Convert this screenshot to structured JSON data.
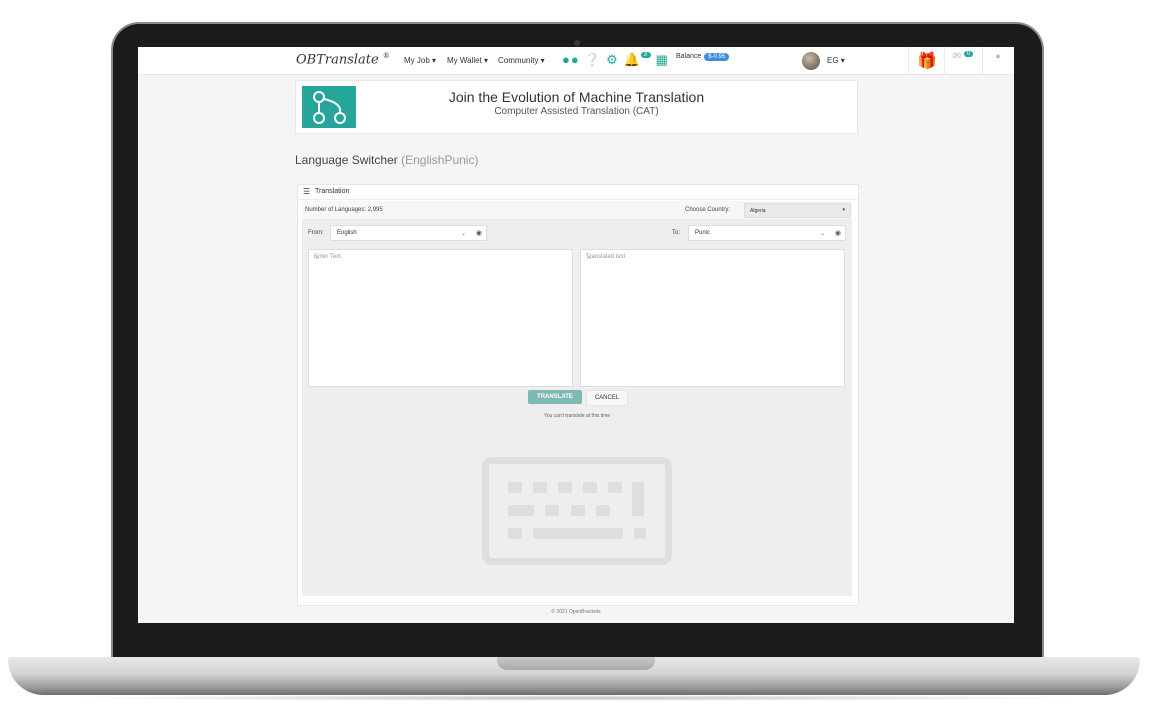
{
  "navbar": {
    "brand": "OBTranslate",
    "brand_mark": "®",
    "menu": [
      "My Job ▾",
      "My Wallet ▾",
      "Community ▾"
    ],
    "notification_count": "3",
    "balance_label": "Balance",
    "balance_value": "$-0.95",
    "language": "EG ▾",
    "mail_count": "0"
  },
  "header": {
    "title": "Join the Evolution of Machine Translation",
    "subtitle": "Computer Assisted Translation (CAT)"
  },
  "page": {
    "title": "Language Switcher",
    "pair": "(EnglishPunic)"
  },
  "panel": {
    "title": "Translation",
    "language_count": "Number of Languages: 2,995",
    "country_label": "Choose Country:",
    "country_value": "Algeria",
    "from_label": "From:",
    "from_value": "English",
    "to_label": "To:",
    "to_value": "Punic",
    "source_placeholder": "Enter Text",
    "target_placeholder": "Translated text",
    "translate_label": "TRANSLATE",
    "cancel_label": "CANCEL",
    "notice": "You can't translate at this time"
  },
  "footer": "© 2021 OpenBrackets",
  "colors": {
    "accent": "#26a69a",
    "balance": "#3b8fd9"
  }
}
